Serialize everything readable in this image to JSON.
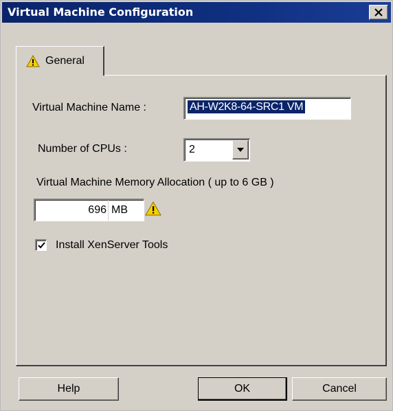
{
  "window": {
    "title": "Virtual Machine Configuration",
    "close_label": "×"
  },
  "tabs": [
    {
      "label": "General",
      "icon": "warning-icon",
      "active": true
    }
  ],
  "form": {
    "vm_name_label": "Virtual Machine Name :",
    "vm_name_value": "AH-W2K8-64-SRC1 VM",
    "cpu_label": "Number of CPUs :",
    "cpu_value": "2",
    "memory_label": "Virtual Machine Memory Allocation ( up to 6 GB )",
    "memory_value": "696",
    "memory_unit": "MB",
    "memory_warning_icon": "warning-icon",
    "install_tools_label": "Install XenServer Tools",
    "install_tools_checked": true
  },
  "buttons": {
    "help": "Help",
    "ok": "OK",
    "cancel": "Cancel"
  },
  "colors": {
    "titlebar": "#0a246a",
    "dialog_bg": "#d4d0c8",
    "selection": "#0a246a",
    "warning_fill": "#f5d000"
  }
}
